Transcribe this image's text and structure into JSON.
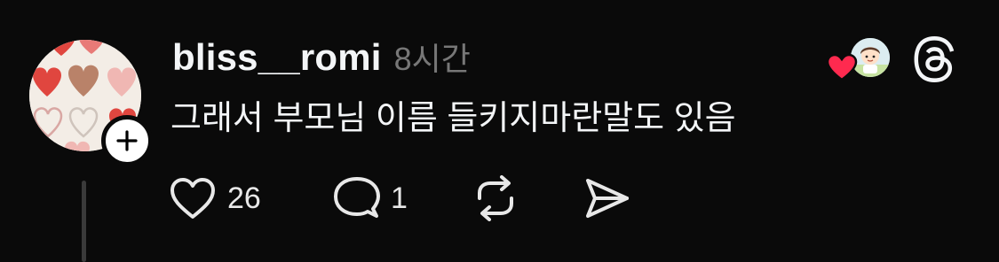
{
  "post": {
    "username": "bliss__romi",
    "time_ago": "8시간",
    "text": "그래서 부모님 이름 들키지마란말도 있음"
  },
  "actions": {
    "likes": "26",
    "replies": "1"
  },
  "icons": {
    "follow": "plus-icon",
    "like": "heart-outline-icon",
    "reply": "speech-bubble-icon",
    "repost": "repost-arrows-icon",
    "share": "paper-plane-icon",
    "app": "threads-logo-icon",
    "liked": "red-heart-icon"
  },
  "colors": {
    "background": "#0a0a0a",
    "text": "#f3f5f7",
    "muted": "#777777",
    "liked_heart": "#ff2a4f"
  }
}
